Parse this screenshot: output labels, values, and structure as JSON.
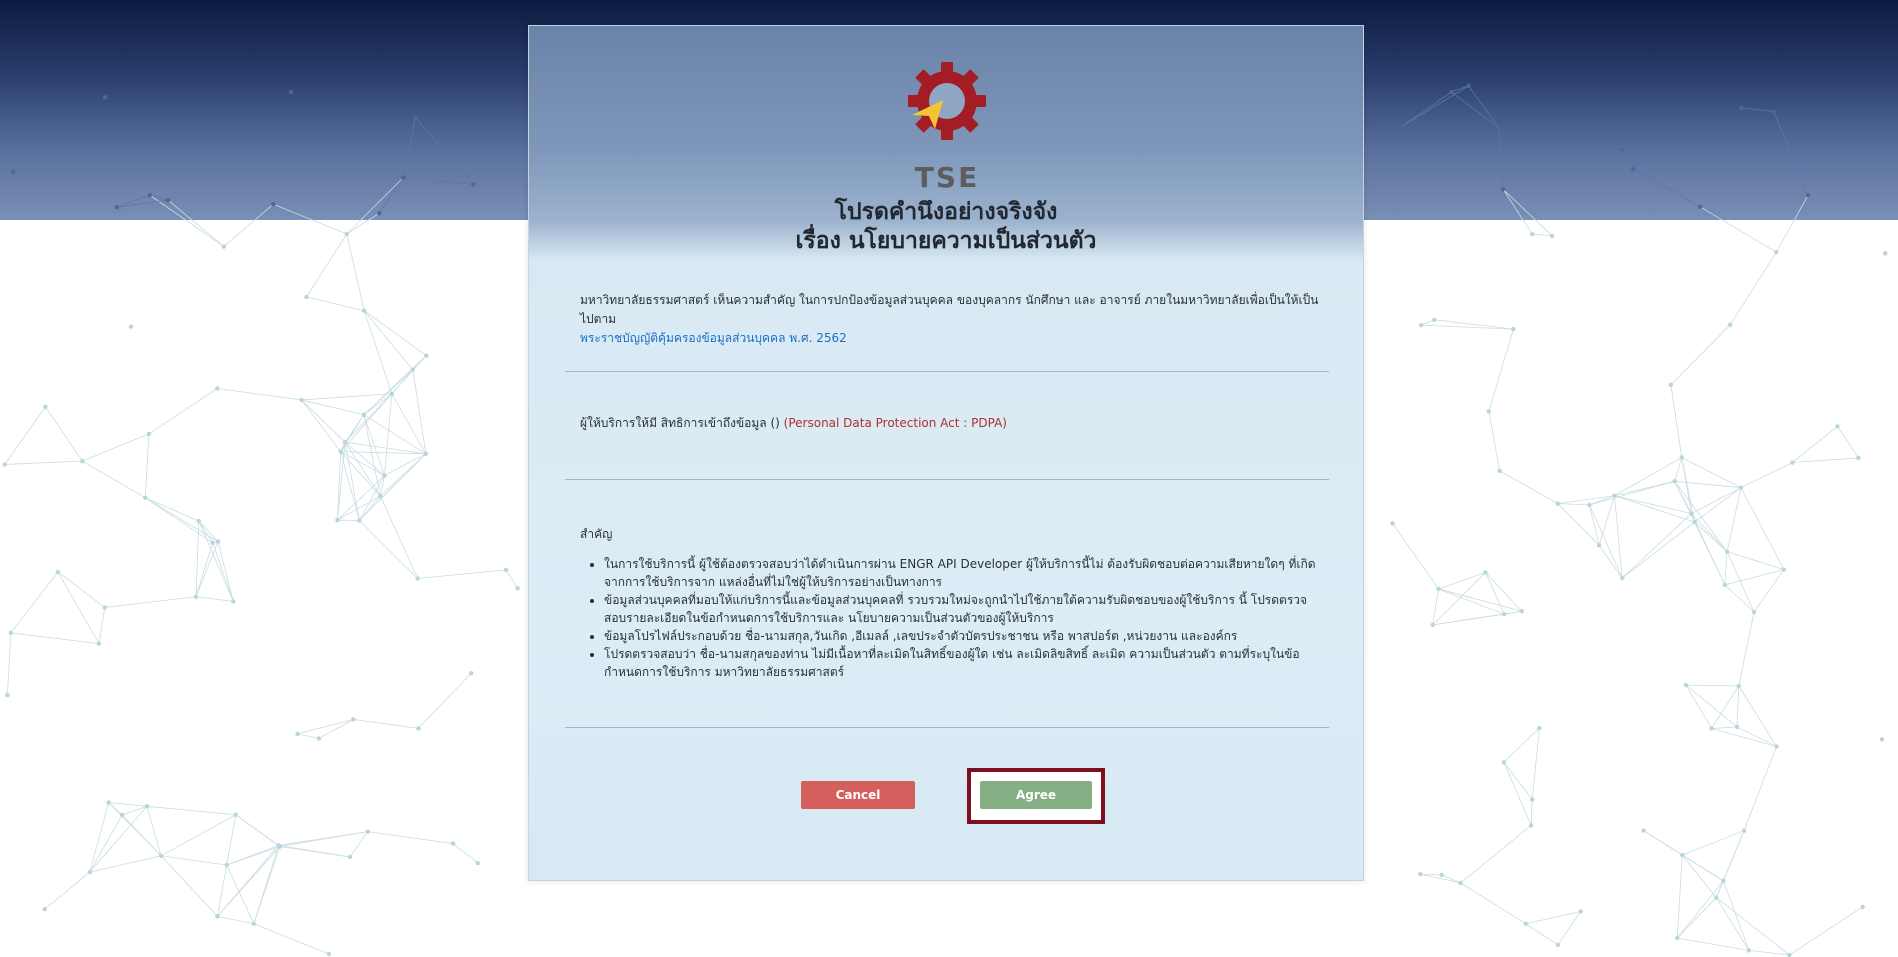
{
  "logo": {
    "text": "TSE",
    "colors": {
      "gear": "#a51d24",
      "arrow": "#f5c336",
      "text": "#5d5d5d"
    }
  },
  "title": {
    "line1": "โปรดคำนึงอย่างจริงจัง",
    "line2": "เรื่อง นโยบายความเป็นส่วนตัว"
  },
  "intro": {
    "text": "มหาวิทยาลัยธรรมศาสตร์ เห็นความสำคัญ ในการปกป้องข้อมูลส่วนบุคคล ของบุคลากร นักศึกษา และ อาจารย์ ภายในมหาวิทยาลัยเพื่อเป็นให้เป็นไปตาม",
    "link": "พระราชบัญญัติคุ้มครองข้อมูลส่วนบุคคล พ.ศ. 2562"
  },
  "rights": {
    "text": "ผู้ให้บริการให้มี สิทธิการเข้าถึงข้อมูล ()",
    "act": "(Personal Data Protection Act : PDPA)"
  },
  "important": {
    "label": "สำคัญ",
    "items": [
      "ในการใช้บริการนี้ ผู้ใช้ต้องตรวจสอบว่าได้ดำเนินการผ่าน ENGR API Developer ผู้ให้บริการนี้ไม่ ต้องรับผิดชอบต่อความเสียหายใดๆ ที่เกิดจากการใช้บริการจาก แหล่งอื่นที่ไม่ใช่ผู้ให้บริการอย่างเป็นทางการ",
      "ข้อมูลส่วนบุคคลที่มอบให้แก่บริการนี้และข้อมูลส่วนบุคคลที่ รวบรวมใหม่จะถูกนำไปใช้ภายใต้ความรับผิดชอบของผู้ใช้บริการ นี้ โปรดตรวจสอบรายละเอียดในข้อกำหนดการใช้บริการและ นโยบายความเป็นส่วนตัวของผู้ให้บริการ",
      "ข้อมูลโปรไฟล์ประกอบด้วย ชื่อ-นามสกุล,วันเกิด ,อีเมลล์ ,เลขประจำตัวบัตรประชาชน หรือ พาสปอร์ต ,หน่วยงาน และองค์กร",
      "โปรดตรวจสอบว่า ชื่อ-นามสกุลของท่าน ไม่มีเนื้อหาที่ละเมิดในสิทธิ์ของผู้ใด เช่น ละเมิดลิขสิทธิ์ ละเมิด ความเป็นส่วนตัว ตามที่ระบุในข้อกำหนดการใช้บริการ มหาวิทยาลัยธรรมศาสตร์"
    ]
  },
  "buttons": {
    "cancel": "Cancel",
    "agree": "Agree"
  },
  "colors": {
    "cancel": "#d45f5d",
    "agree": "#84ae84",
    "highlight_frame": "#7e0f1f",
    "link": "#1e6fc4",
    "act": "#b0302d"
  }
}
